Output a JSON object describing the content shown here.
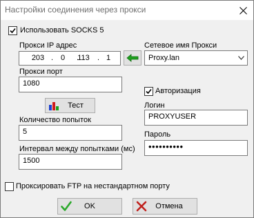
{
  "window": {
    "title": "Настройки соединения через прокси"
  },
  "socks": {
    "label": "Использовать SOCKS 5",
    "checked": true
  },
  "proxy_ip": {
    "label": "Прокси IP адрес",
    "octets": [
      "203",
      "0",
      "113",
      "1"
    ]
  },
  "proxy_name": {
    "label": "Сетевое имя Прокси",
    "value": "Proxy.lan"
  },
  "proxy_port": {
    "label": "Прокси порт",
    "value": "1080"
  },
  "test_button": {
    "label": "Тест",
    "icon": "bar-chart-icon"
  },
  "attempts": {
    "label": "Количество попыток",
    "value": "5"
  },
  "interval": {
    "label": "Интервал между попытками (мс)",
    "value": "1500"
  },
  "auth": {
    "label": "Авторизация",
    "checked": true,
    "login_label": "Логин",
    "login_value": "PROXYUSER",
    "password_label": "Пароль",
    "password_value": "••••••••••"
  },
  "ftp": {
    "label": "Проксировать FTP на нестандартном порту",
    "checked": false
  },
  "ok_button": {
    "label": "OK",
    "icon": "checkmark-icon"
  },
  "cancel_button": {
    "label": "Отмена",
    "icon": "cross-icon"
  },
  "colors": {
    "arrow_green": "#1fa01f",
    "ok_green": "#2aa82a",
    "cancel_red": "#c0201c"
  }
}
